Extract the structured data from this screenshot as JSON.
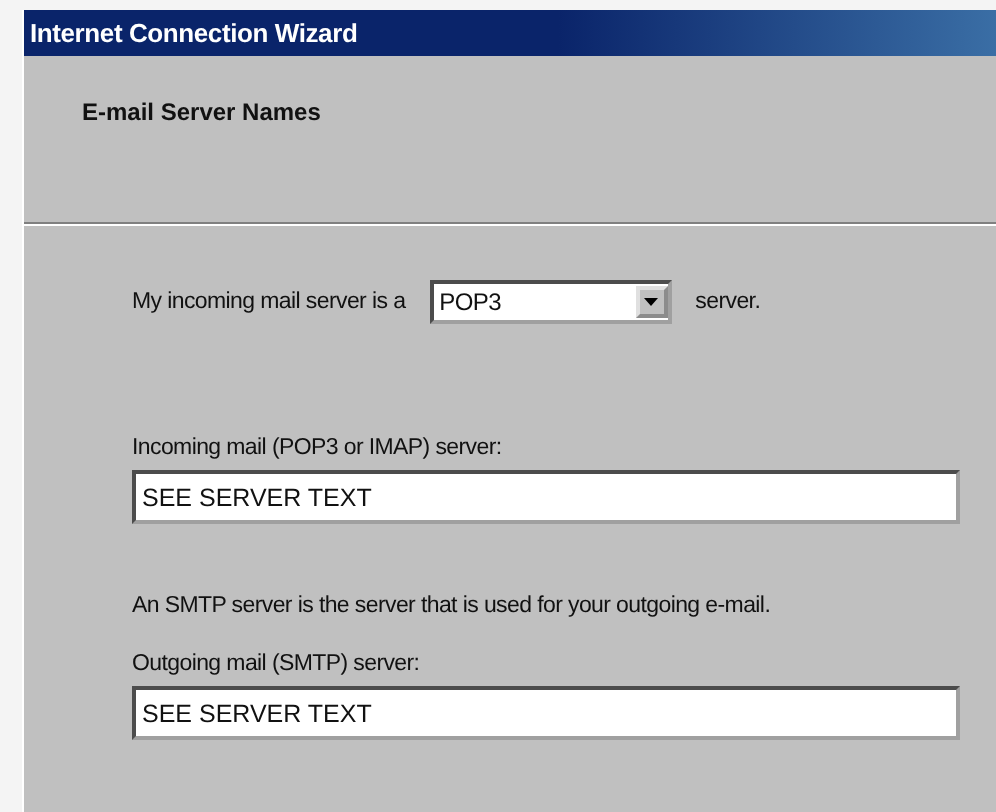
{
  "window": {
    "title": "Internet Connection Wizard"
  },
  "header": {
    "title": "E-mail Server Names"
  },
  "server_type": {
    "prefix": "My incoming mail server is a",
    "value": "POP3",
    "suffix": "server."
  },
  "incoming": {
    "label": "Incoming mail (POP3 or IMAP) server:",
    "value": "SEE SERVER TEXT"
  },
  "smtp_note": "An SMTP server is the server that is used for your outgoing e-mail.",
  "outgoing": {
    "label": "Outgoing mail (SMTP) server:",
    "value": "SEE SERVER TEXT"
  }
}
